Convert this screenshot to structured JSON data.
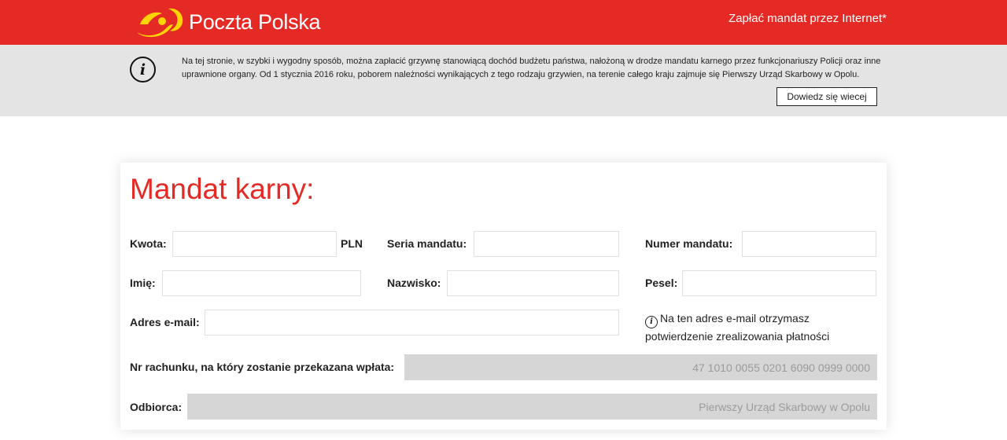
{
  "header": {
    "brand": "Poczta Polska",
    "link": "Zapłać mandat przez Internet*",
    "brand_color": "#e52a25"
  },
  "info": {
    "text": "Na tej stronie, w szybki i wygodny sposób, można zapłacić grzywnę stanowiącą dochód budżetu państwa, nałożoną w drodze mandatu karnego przez funkcjonariuszy Policji oraz inne uprawnione organy. Od 1 stycznia 2016 roku, poborem należności wynikających z tego rodzaju grzywien, na terenie całego kraju zajmuje się Pierwszy Urząd Skarbowy w Opolu.",
    "button": "Dowiedz się wiecej",
    "icon": "info-icon"
  },
  "form": {
    "title": "Mandat karny:",
    "kwota_label": "Kwota:",
    "currency": "PLN",
    "seria_label": "Seria mandatu:",
    "numer_label": "Numer mandatu:",
    "imie_label": "Imię:",
    "nazwisko_label": "Nazwisko:",
    "pesel_label": "Pesel:",
    "email_label": "Adres e-mail:",
    "email_note": "Na ten adres e-mail otrzymasz potwierdzenie zrealizowania płatności",
    "account_label": "Nr rachunku, na który zostanie przekazana wpłata:",
    "account_value": "47 1010 0055 0201 6090 0999 0000",
    "recipient_label": "Odbiorca:",
    "recipient_value": "Pierwszy Urząd Skarbowy w Opolu"
  }
}
